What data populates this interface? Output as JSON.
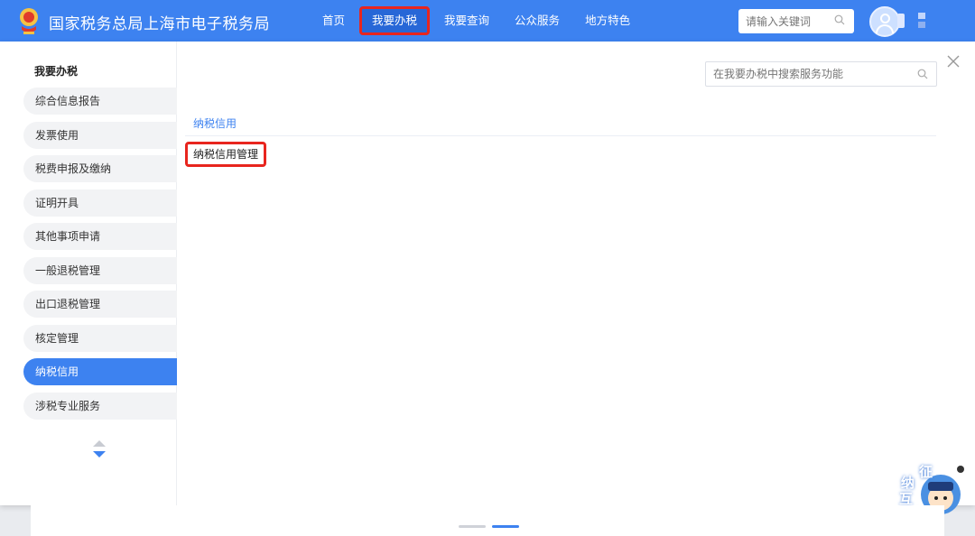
{
  "header": {
    "title": "国家税务总局上海市电子税务局",
    "nav": [
      {
        "label": "首页"
      },
      {
        "label": "我要办税"
      },
      {
        "label": "我要查询"
      },
      {
        "label": "公众服务"
      },
      {
        "label": "地方特色"
      }
    ],
    "active_nav": "我要办税",
    "search_placeholder": "请输入关键词",
    "brand_color": "#3d82f0",
    "highlight_color": "#e8251e"
  },
  "sidebar": {
    "title": "我要办税",
    "items": [
      {
        "label": "综合信息报告"
      },
      {
        "label": "发票使用"
      },
      {
        "label": "税费申报及缴纳"
      },
      {
        "label": "证明开具"
      },
      {
        "label": "其他事项申请"
      },
      {
        "label": "一般退税管理"
      },
      {
        "label": "出口退税管理"
      },
      {
        "label": "核定管理"
      },
      {
        "label": "纳税信用"
      },
      {
        "label": "涉税专业服务"
      }
    ],
    "active_item": "纳税信用"
  },
  "content": {
    "search_placeholder": "在我要办税中搜索服务功能",
    "section_title": "纳税信用",
    "services": [
      {
        "label": "纳税信用管理"
      }
    ]
  },
  "assistant": {
    "chars": [
      "征",
      "纳",
      "互",
      "动"
    ]
  }
}
